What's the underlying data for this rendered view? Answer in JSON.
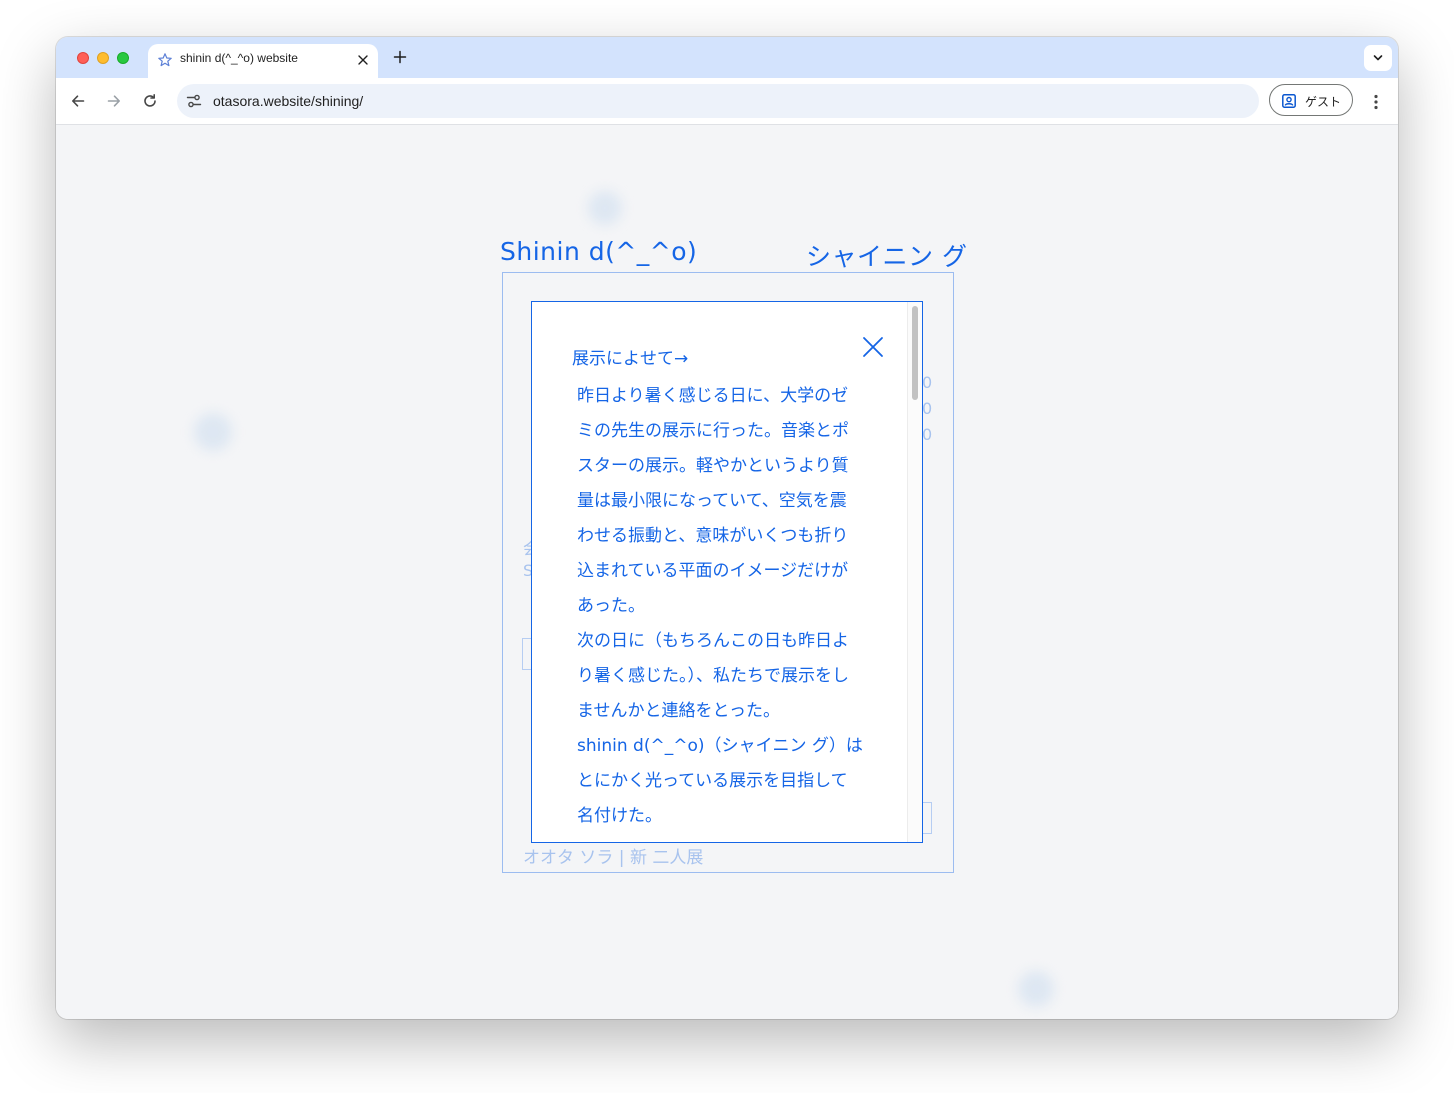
{
  "browser": {
    "tab_title": "shinin d(^_^o) website",
    "url": "otasora.website/shining/",
    "guest_label": "ゲスト"
  },
  "site": {
    "title_en": "Shinin d(^_^o)",
    "title_ja": "シャイニン グ"
  },
  "background_fragments": {
    "right_digits": [
      "0",
      "0",
      "0"
    ],
    "left_chars": [
      "会",
      "S"
    ],
    "footer": "オオタ ソラ | 新 二人展"
  },
  "modal": {
    "heading": "展示によせて→",
    "paragraphs": [
      "昨日より暑く感じる日に、大学のゼ\nミの先生の展示に行った。音楽とポ\nスターの展示。軽やかというより質\n量は最小限になっていて、空気を震\nわせる振動と、意味がいくつも折り\n込まれている平面のイメージだけが\nあった。",
      "次の日に（もちろんこの日も昨日よ\nり暑く感じた。）、私たちで展示をし\nませんかと連絡をとった。",
      "shinin d(^_^o)（シャイニン グ）は\nとにかく光っている展示を目指して\n名付けた。"
    ]
  },
  "colors": {
    "accent": "#1565e6",
    "faded": "#a8c3ee",
    "page_bg": "#f4f5f7",
    "tabstrip_bg": "#d3e3fd"
  },
  "icons": [
    "star-icon",
    "close-icon",
    "plus-icon",
    "chevron-down-icon",
    "back-arrow-icon",
    "forward-arrow-icon",
    "reload-icon",
    "site-settings-icon",
    "guest-profile-icon",
    "more-vert-icon"
  ]
}
